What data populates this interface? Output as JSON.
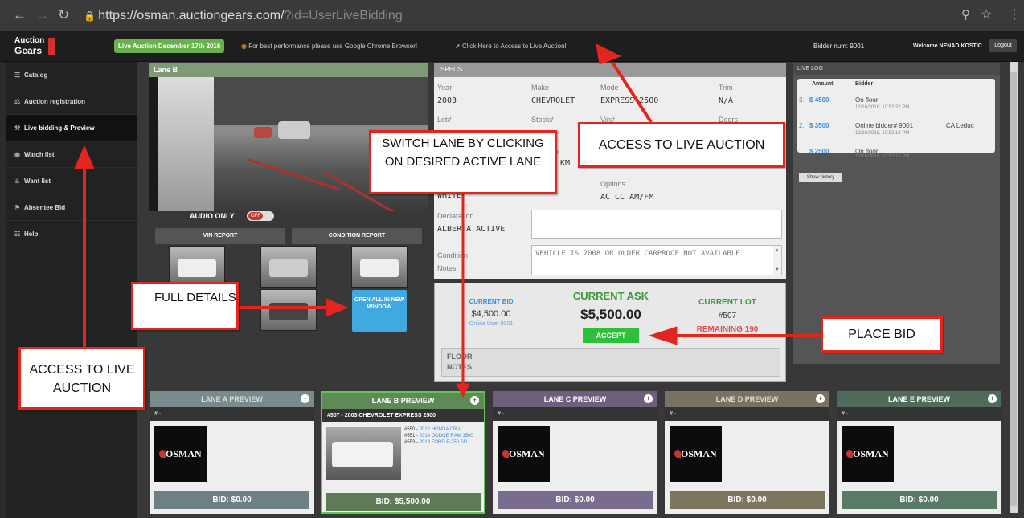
{
  "browser": {
    "url_host": "https://osman.auctiongears.com/",
    "url_query": "?id=UserLiveBidding",
    "back_icon": "back-arrow-icon",
    "forward_icon": "forward-arrow-icon",
    "reload_icon": "reload-icon"
  },
  "header": {
    "logo_line1": "Auction",
    "logo_line2": "Gears",
    "event_label": "Live Auction December 17th 2016",
    "chrome_notice": "For best performance please use Google Chrome Browser!",
    "access_link": "Click Here to Access to Live Auction!",
    "bidder_num": "Bidder num: 9001",
    "welcome": "Welcome NENAD KOSTIC",
    "logout": "Logout"
  },
  "sidebar": {
    "items": [
      {
        "label": "Catalog"
      },
      {
        "label": "Auction registration"
      },
      {
        "label": "Live bidding & Preview"
      },
      {
        "label": "Watch list"
      },
      {
        "label": "Want list"
      },
      {
        "label": "Absentee Bid"
      },
      {
        "label": "Help"
      }
    ]
  },
  "video": {
    "lane_title": "Lane B",
    "audio_only": "AUDIO ONLY",
    "toggle_state": "OFF",
    "vin_report": "VIN REPORT",
    "condition_report": "CONDITION REPORT",
    "open_new_window": "OPEN ALL IN NEW WINDOW"
  },
  "specs": {
    "header": "SPECS",
    "year_label": "Year",
    "year": "2003",
    "make_label": "Make",
    "make": "CHEVROLET",
    "model_label": "Mode",
    "model": "EXPRESS 2500",
    "trim_label": "Trim",
    "trim": "N/A",
    "lot_label": "Lot#",
    "stock_label": "Stock#",
    "vin_label": "Vin#",
    "doors_label": "Doors",
    "mileage_frag": "ge",
    "mileage_val": "8 KM",
    "color_frag": "r",
    "color_val": "WHITE",
    "options_label": "Options",
    "options_val": "AC CC AM/FM",
    "declaration_label": "Declaration",
    "declaration_val": "ALBERTA ACTIVE",
    "condition_label": "Condition Notes",
    "condition_val": "VEHICLE IS 2008 OR OLDER CARPROOF NOT AVAILABLE"
  },
  "bid": {
    "current_bid_label": "CURRENT BID",
    "current_bid": "$4,500.00",
    "current_bid_user": "Online User 9001",
    "current_ask_label": "CURRENT ASK",
    "current_ask": "$5,500.00",
    "accept": "ACCEPT",
    "current_lot_label": "CURRENT LOT",
    "current_lot": "#507",
    "remaining": "REMAINING 190",
    "floor_notes": "FLOOR NOTES"
  },
  "livelog": {
    "header": "LIVE LOG",
    "col_amount": "Amount",
    "col_bidder": "Bidder",
    "rows": [
      {
        "n": "3.",
        "amount": "$ 4500",
        "bidder": "On floor",
        "loc": "",
        "ts": "12/16/2016, 10:52:22 PM"
      },
      {
        "n": "2.",
        "amount": "$ 3500",
        "bidder": "Online bidder# 9001",
        "loc": "CA Leduc",
        "ts": "12/16/2016, 10:52:18 PM"
      },
      {
        "n": "1.",
        "amount": "$ 2500",
        "bidder": "On floor",
        "loc": "",
        "ts": "12/16/2016, 10:52:12 PM"
      }
    ],
    "show_history": "Show history"
  },
  "lanes": [
    {
      "title": "LANE A PREVIEW",
      "sub": "# -",
      "bid": "BID: $0.00",
      "color": "#7a8b8c",
      "bidcolor": "#6d8086"
    },
    {
      "title": "LANE B PREVIEW",
      "sub": "#507 - 2003 CHEVROLET EXPRESS 2500",
      "bid": "BID: $5,500.00",
      "color": "#5d8a55",
      "bidcolor": "#5e7a56"
    },
    {
      "title": "LANE C PREVIEW",
      "sub": "# -",
      "bid": "BID: $0.00",
      "color": "#6d5f7d",
      "bidcolor": "#7a6c8c"
    },
    {
      "title": "LANE D PREVIEW",
      "sub": "# -",
      "bid": "BID: $0.00",
      "color": "#7a7260",
      "bidcolor": "#7d7560"
    },
    {
      "title": "LANE E PREVIEW",
      "sub": "# -",
      "bid": "BID: $0.00",
      "color": "#4f6b5c",
      "bidcolor": "#587a66"
    }
  ],
  "laneB_list": [
    {
      "lot": "#550 -",
      "name": "2012 HONDA CR-V"
    },
    {
      "lot": "#551 -",
      "name": "2014 DODGE RAM 1500"
    },
    {
      "lot": "#553 -",
      "name": "2013 FORD F-250 SD"
    }
  ],
  "osman_logo": "OSMAN",
  "annotations": {
    "switch_lane": "SWITCH LANE BY CLICKING ON DESIRED ACTIVE LANE",
    "access_live_top": "ACCESS TO LIVE AUCTION",
    "access_live_side": "ACCESS TO LIVE AUCTION",
    "full_details": "FULL DETAILS",
    "place_bid": "PLACE BID"
  },
  "colors": {
    "accent_red": "#e3241f",
    "accept_green": "#2ebf3b",
    "blue": "#3b8ad9"
  }
}
